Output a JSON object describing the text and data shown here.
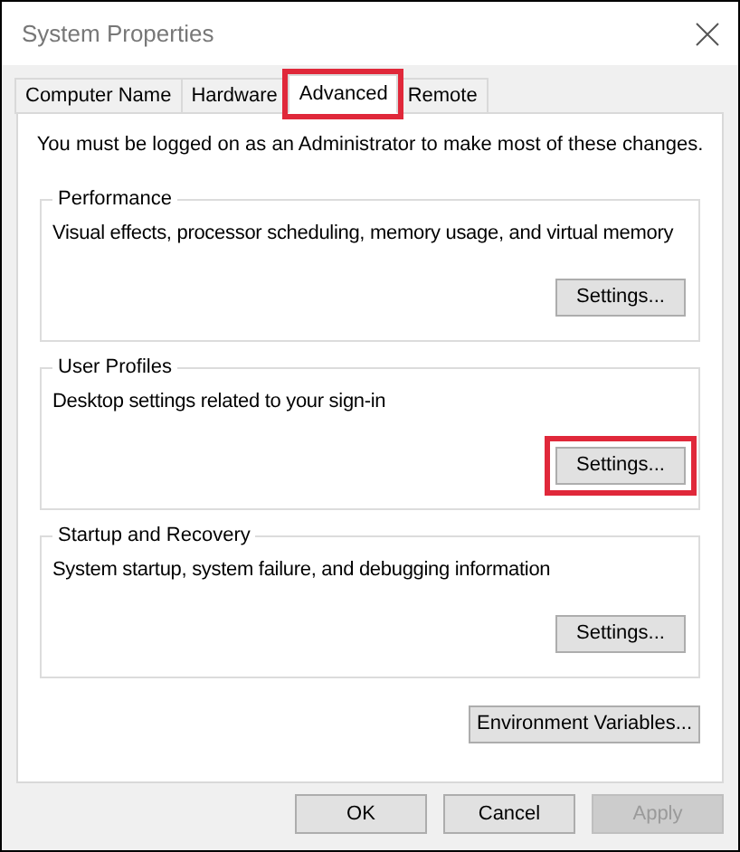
{
  "window": {
    "title": "System Properties"
  },
  "tabs": [
    {
      "label": "Computer Name",
      "selected": false,
      "highlighted": false
    },
    {
      "label": "Hardware",
      "selected": false,
      "highlighted": false
    },
    {
      "label": "Advanced",
      "selected": true,
      "highlighted": true
    },
    {
      "label": "Remote",
      "selected": false,
      "highlighted": false
    }
  ],
  "notice": "You must be logged on as an Administrator to make most of these changes.",
  "groups": [
    {
      "title": "Performance",
      "description": "Visual effects, processor scheduling, memory usage, and virtual memory",
      "button": {
        "label": "Settings...",
        "highlighted": false
      }
    },
    {
      "title": "User Profiles",
      "description": "Desktop settings related to your sign-in",
      "button": {
        "label": "Settings...",
        "highlighted": true
      }
    },
    {
      "title": "Startup and Recovery",
      "description": "System startup, system failure, and debugging information",
      "button": {
        "label": "Settings...",
        "highlighted": false
      }
    }
  ],
  "environment_button": {
    "label": "Environment Variables..."
  },
  "buttons": [
    {
      "label": "OK",
      "disabled": false
    },
    {
      "label": "Cancel",
      "disabled": false
    },
    {
      "label": "Apply",
      "disabled": true
    }
  ]
}
